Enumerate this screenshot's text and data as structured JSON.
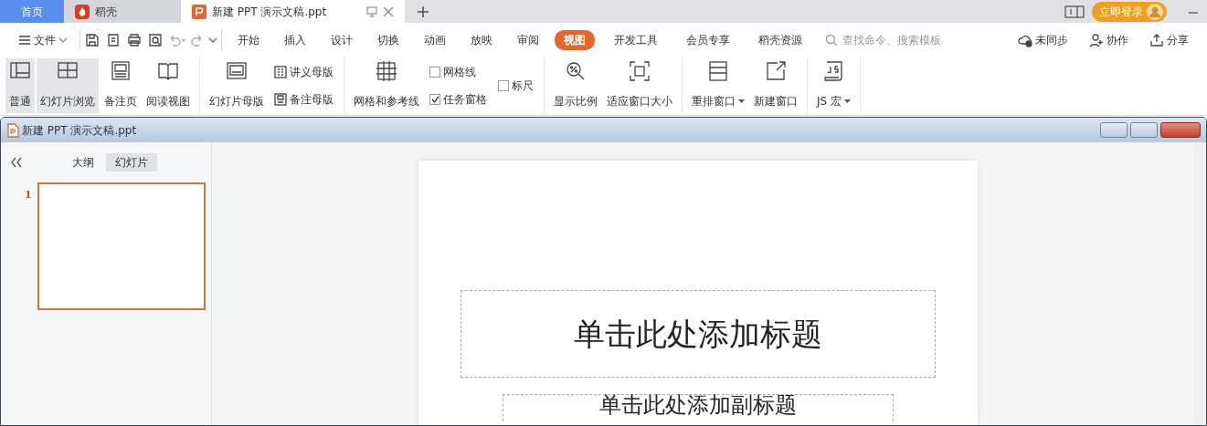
{
  "tabs": [
    {
      "label": "首页",
      "selected": false,
      "kind": "home"
    },
    {
      "label": "稻壳",
      "selected": false,
      "kind": "app"
    },
    {
      "label": "新建 PPT 演示文稿.ppt",
      "selected": true,
      "kind": "doc"
    }
  ],
  "login": "立即登录",
  "menu": {
    "file": "文件",
    "tabs": [
      {
        "label": "开始",
        "selected": false
      },
      {
        "label": "插入",
        "selected": false
      },
      {
        "label": "设计",
        "selected": false
      },
      {
        "label": "切换",
        "selected": false
      },
      {
        "label": "动画",
        "selected": false
      },
      {
        "label": "放映",
        "selected": false
      },
      {
        "label": "审阅",
        "selected": false
      },
      {
        "label": "视图",
        "selected": true
      },
      {
        "label": "开发工具",
        "selected": false
      },
      {
        "label": "会员专享",
        "selected": false
      },
      {
        "label": "稻壳资源",
        "selected": false
      }
    ],
    "search": {
      "placeholder": "查找命令、搜索模板"
    },
    "actions": [
      "未同步",
      "协作",
      "分享"
    ]
  },
  "ribbon": [
    {
      "columns": [
        {
          "kind": "large",
          "label": "普通",
          "selected": true
        },
        {
          "kind": "large",
          "label": "幻灯片浏览",
          "selected": true
        },
        {
          "kind": "large",
          "label": "备注页",
          "selected": false
        },
        {
          "kind": "large",
          "label": "阅读视图",
          "selected": false
        }
      ]
    },
    {
      "columns": [
        {
          "kind": "large",
          "label": "幻灯片母版",
          "selected": false
        },
        {
          "kind": "stack",
          "items": [
            {
              "kind": "small",
              "label": "讲义母版"
            },
            {
              "kind": "small",
              "label": "备注母版"
            }
          ]
        }
      ]
    },
    {
      "columns": [
        {
          "kind": "large",
          "label": "网格和参考线",
          "selected": false
        },
        {
          "kind": "stack",
          "items": [
            {
              "kind": "check",
              "label": "网格线",
              "checked": false
            },
            {
              "kind": "check",
              "label": "任务窗格",
              "checked": true
            }
          ]
        },
        {
          "kind": "stack",
          "items": [
            {
              "kind": "check",
              "label": "标尺",
              "checked": false
            }
          ]
        }
      ]
    },
    {
      "columns": [
        {
          "kind": "large",
          "label": "显示比例",
          "selected": false
        },
        {
          "kind": "large",
          "label": "适应窗口大小",
          "selected": false
        }
      ]
    },
    {
      "columns": [
        {
          "kind": "large",
          "label": "重排窗口",
          "selected": false,
          "dropdown": true
        },
        {
          "kind": "large",
          "label": "新建窗口",
          "selected": false
        }
      ]
    },
    {
      "columns": [
        {
          "kind": "large",
          "label": "JS 宏",
          "selected": false,
          "dropdown": true
        }
      ]
    }
  ],
  "document": {
    "title": "新建 PPT 演示文稿.ppt",
    "panel_tabs": [
      {
        "label": "大纲",
        "selected": false
      },
      {
        "label": "幻灯片",
        "selected": true
      }
    ],
    "slides": [
      {
        "number": "1",
        "selected": true
      }
    ],
    "slide": {
      "title_placeholder": "单击此处添加标题",
      "subtitle_placeholder": "单击此处添加副标题"
    }
  }
}
